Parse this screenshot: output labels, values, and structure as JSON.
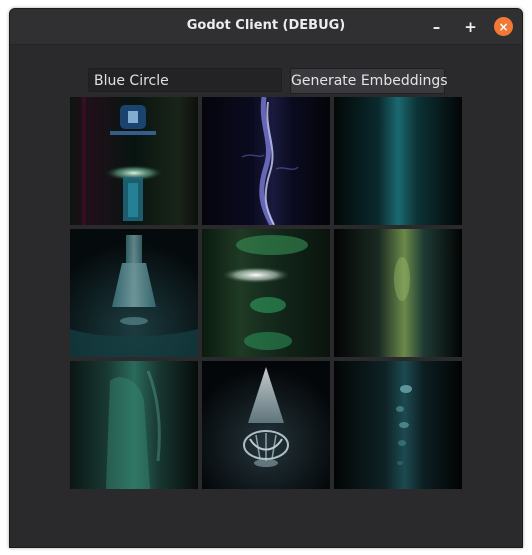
{
  "window": {
    "title": "Godot Client (DEBUG)",
    "controls": {
      "minimize": "–",
      "maximize": "+",
      "close": "×"
    },
    "accent_close": "#f27835"
  },
  "prompt": {
    "value": "Blue Circle"
  },
  "generate_button": {
    "label": "Generate Embeddings"
  },
  "images": [
    {
      "name": "generated-image-1",
      "description_icon": "image"
    },
    {
      "name": "generated-image-2",
      "description_icon": "image"
    },
    {
      "name": "generated-image-3",
      "description_icon": "image"
    },
    {
      "name": "generated-image-4",
      "description_icon": "image"
    },
    {
      "name": "generated-image-5",
      "description_icon": "image"
    },
    {
      "name": "generated-image-6",
      "description_icon": "image"
    },
    {
      "name": "generated-image-7",
      "description_icon": "image"
    },
    {
      "name": "generated-image-8",
      "description_icon": "image"
    },
    {
      "name": "generated-image-9",
      "description_icon": "image"
    }
  ]
}
